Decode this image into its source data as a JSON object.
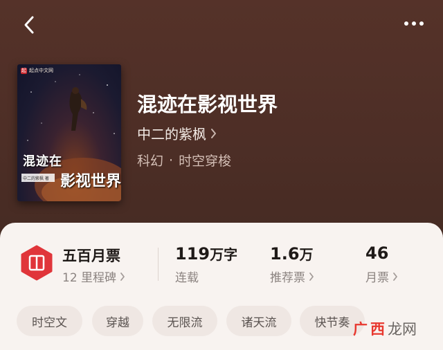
{
  "header": {
    "back_icon": "chevron-left-icon",
    "more_icon": "more-horizontal-icon"
  },
  "cover": {
    "publisher": "起点中文网",
    "title_line1": "混迹在",
    "title_line2": "影视世界",
    "author": "中二的紫枫 著"
  },
  "book": {
    "title": "混迹在影视世界",
    "author": "中二的紫枫",
    "category": "科幻",
    "separator": "·",
    "subcategory": "时空穿梭"
  },
  "stats": {
    "rank_title": "五百月票",
    "rank_sub": "12 里程碑",
    "words_value": "119",
    "words_unit": "万字",
    "words_label": "连载",
    "rec_value": "1.6",
    "rec_unit": "万",
    "rec_label": "推荐票",
    "monthly_value": "46",
    "monthly_label": "月票"
  },
  "tags": [
    "时空文",
    "穿越",
    "无限流",
    "诸天流",
    "快节奏"
  ],
  "watermark": {
    "left": "广",
    "middle": "西",
    "right": "龙网"
  },
  "colors": {
    "header_bg": "#4d2e26",
    "sheet_bg": "#f8f3f0",
    "badge_red": "#e0353a",
    "tag_bg": "#efe7e3"
  }
}
